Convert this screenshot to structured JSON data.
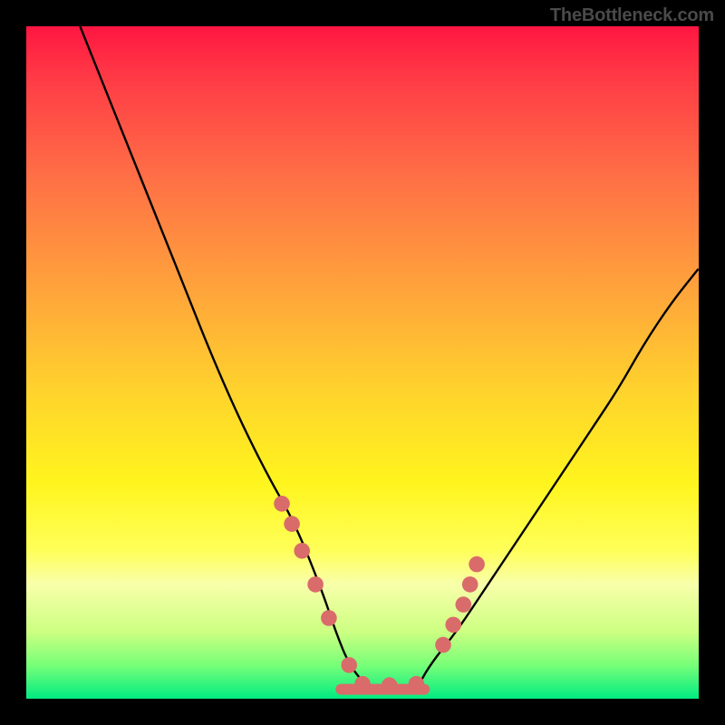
{
  "watermark": "TheBottleneck.com",
  "chart_data": {
    "type": "line",
    "title": "",
    "xlabel": "",
    "ylabel": "",
    "xlim": [
      0,
      100
    ],
    "ylim": [
      0,
      100
    ],
    "curve": {
      "name": "bottleneck-curve",
      "x": [
        8,
        12,
        16,
        20,
        24,
        28,
        32,
        36,
        40,
        44,
        46,
        48,
        51,
        55,
        58,
        60,
        64,
        68,
        72,
        76,
        80,
        84,
        88,
        92,
        96,
        100
      ],
      "y": [
        100,
        90,
        80,
        70,
        60,
        50,
        41,
        33,
        26,
        16,
        10,
        5,
        1.4,
        1.4,
        1.4,
        5,
        10,
        16,
        22,
        28,
        34,
        40,
        46,
        53,
        59,
        64
      ]
    },
    "markers": {
      "name": "highlight-dots",
      "color": "#d96b6b",
      "x": [
        38,
        39.5,
        41,
        43,
        45,
        48,
        50,
        54,
        58,
        62,
        63.5,
        65,
        66,
        67
      ],
      "y": [
        29,
        26,
        22,
        17,
        12,
        5,
        2.2,
        2.0,
        2.2,
        8,
        11,
        14,
        17,
        20
      ]
    },
    "flat_bar": {
      "color": "#d96b6b",
      "x0": 46,
      "x1": 60,
      "y": 1.4
    },
    "gradient_stops": [
      {
        "pos": 0.0,
        "color": "#ff1641"
      },
      {
        "pos": 0.5,
        "color": "#ffd22d"
      },
      {
        "pos": 0.82,
        "color": "#f6ffb0"
      },
      {
        "pos": 1.0,
        "color": "#00eb82"
      }
    ]
  }
}
